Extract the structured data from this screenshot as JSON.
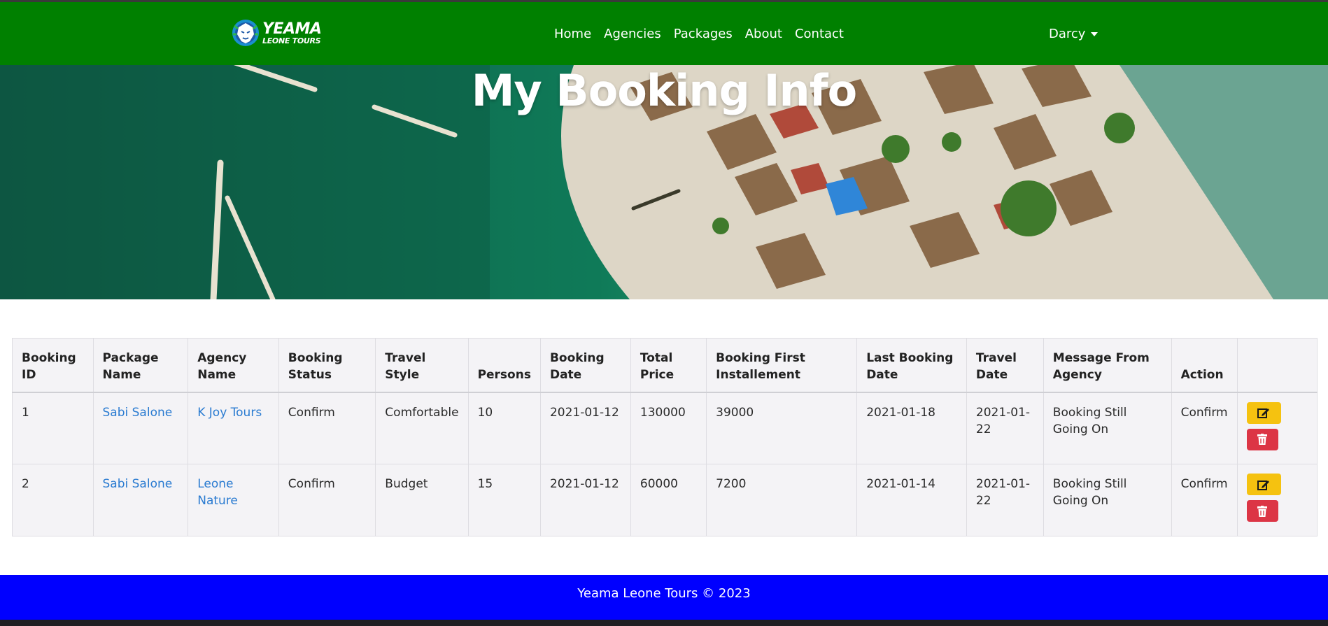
{
  "brand": {
    "line1": "YEAMA",
    "line2": "LEONE TOURS"
  },
  "nav": {
    "links": [
      "Home",
      "Agencies",
      "Packages",
      "About",
      "Contact"
    ],
    "user": "Darcy"
  },
  "hero": {
    "title": "My Booking Info"
  },
  "table": {
    "headers": [
      "Booking ID",
      "Package Name",
      "Agency Name",
      "Booking Status",
      "Travel Style",
      "Persons",
      "Booking Date",
      "Total Price",
      "Booking First Installement",
      "Last Booking Date",
      "Travel Date",
      "Message From Agency",
      "Action",
      ""
    ],
    "rows": [
      {
        "id": "1",
        "package": "Sabi Salone",
        "agency": "K Joy Tours",
        "status": "Confirm",
        "style": "Comfortable",
        "persons": "10",
        "booking_date": "2021-01-12",
        "total_price": "130000",
        "first_installment": "39000",
        "last_booking_date": "2021-01-18",
        "travel_date": "2021-01-22",
        "message": "Booking Still Going On",
        "action": "Confirm"
      },
      {
        "id": "2",
        "package": "Sabi Salone",
        "agency": "Leone Nature",
        "status": "Confirm",
        "style": "Budget",
        "persons": "15",
        "booking_date": "2021-01-12",
        "total_price": "60000",
        "first_installment": "7200",
        "last_booking_date": "2021-01-14",
        "travel_date": "2021-01-22",
        "message": "Booking Still Going On",
        "action": "Confirm"
      }
    ]
  },
  "footer": {
    "text": "Yeama Leone Tours © 2023"
  },
  "icons": {
    "edit": "edit-icon",
    "delete": "trash-icon"
  },
  "colors": {
    "navbar": "#008000",
    "footer": "#0000ff",
    "edit_button": "#f5c210",
    "delete_button": "#dc3545",
    "link": "#2a7bd1"
  }
}
